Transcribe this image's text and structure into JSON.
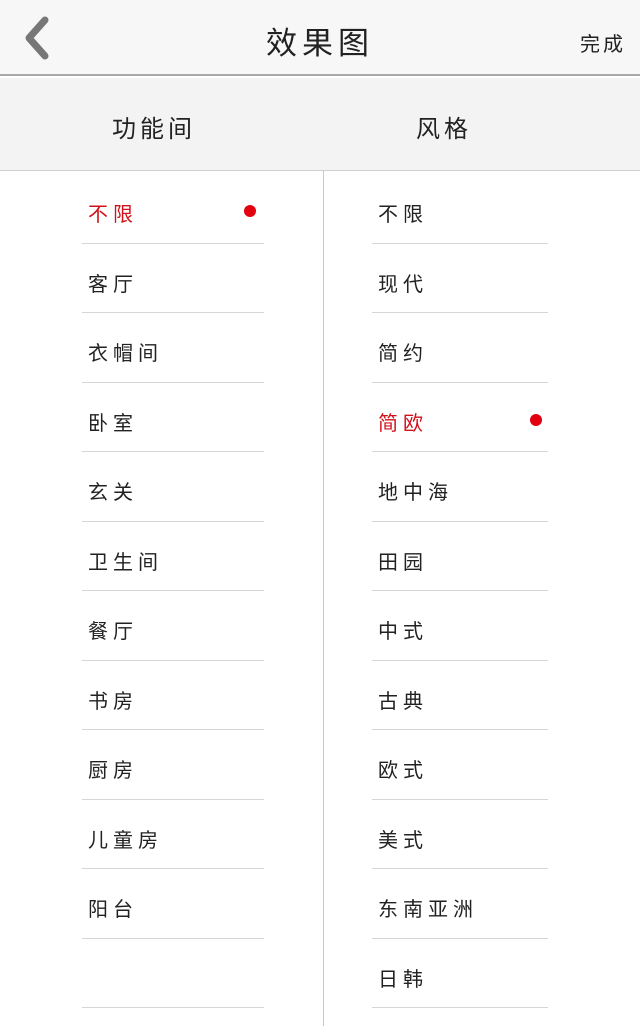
{
  "navbar": {
    "title": "效果图",
    "done_label": "完成",
    "back_icon": "chevron-left-icon"
  },
  "filters": {
    "room_tab_label": "功能间",
    "style_tab_label": "风格"
  },
  "room_list": {
    "selected": "不限",
    "items": [
      "不限",
      "客厅",
      "衣帽间",
      "卧室",
      "玄关",
      "卫生间",
      "餐厅",
      "书房",
      "厨房",
      "儿童房",
      "阳台",
      ""
    ]
  },
  "style_list": {
    "selected": "简欧",
    "items": [
      "不限",
      "现代",
      "简约",
      "简欧",
      "地中海",
      "田园",
      "中式",
      "古典",
      "欧式",
      "美式",
      "东南亚洲",
      "日韩"
    ]
  },
  "colors": {
    "accent": "#e3000f",
    "selected_text": "#d0121b",
    "divider": "#d6d6d6",
    "navbar_bg": "#f7f7f7"
  }
}
